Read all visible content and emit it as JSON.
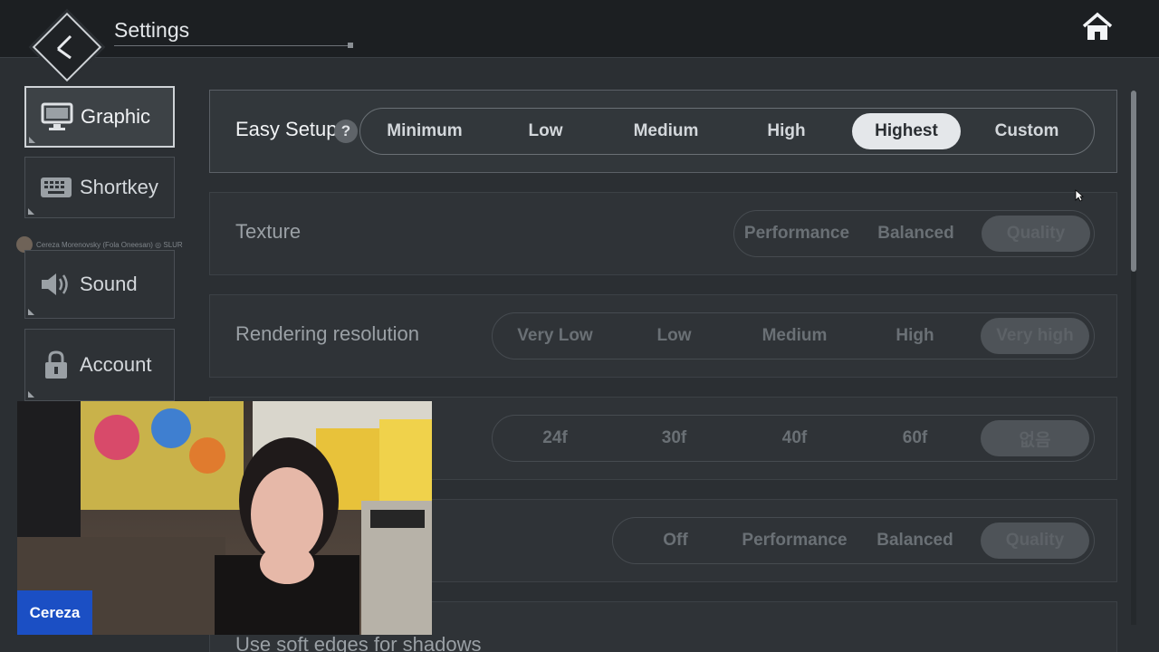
{
  "header": {
    "title": "Settings",
    "back_icon": "back-arrow-icon",
    "home_icon": "home-icon"
  },
  "sidebar": {
    "items": [
      {
        "label": "Graphic",
        "icon": "monitor-icon",
        "active": true
      },
      {
        "label": "Shortkey",
        "icon": "keyboard-icon",
        "active": false
      },
      {
        "label": "Sound",
        "icon": "speaker-icon",
        "active": false
      },
      {
        "label": "Account",
        "icon": "lock-icon",
        "active": false
      }
    ]
  },
  "overlay_caption": "Cereza Morenovsky (Fola Oneesan)  ◎ SLUR",
  "settings": {
    "easy_setup": {
      "label": "Easy Setup",
      "help": "?",
      "options": [
        "Minimum",
        "Low",
        "Medium",
        "High",
        "Highest",
        "Custom"
      ],
      "selected": "Highest"
    },
    "texture": {
      "label": "Texture",
      "options": [
        "Performance",
        "Balanced",
        "Quality"
      ],
      "selected": "Quality"
    },
    "rendering_resolution": {
      "label": "Rendering resolution",
      "options": [
        "Very Low",
        "Low",
        "Medium",
        "High",
        "Very high"
      ],
      "selected": "Very high"
    },
    "frame_rate": {
      "label": "",
      "options": [
        "24f",
        "30f",
        "40f",
        "60f",
        "없음"
      ],
      "selected": "없음"
    },
    "fourth_setting": {
      "label": "",
      "options": [
        "Off",
        "Performance",
        "Balanced",
        "Quality"
      ],
      "selected": "Quality"
    },
    "soft_shadows": {
      "label": "Use soft edges for shadows"
    }
  },
  "webcam": {
    "name": "Cereza",
    "badge_color": "#1b4fc4"
  },
  "colors": {
    "accent": "#e4e7ea",
    "background": "#2b2f33",
    "topbar": "#1c1f22"
  }
}
